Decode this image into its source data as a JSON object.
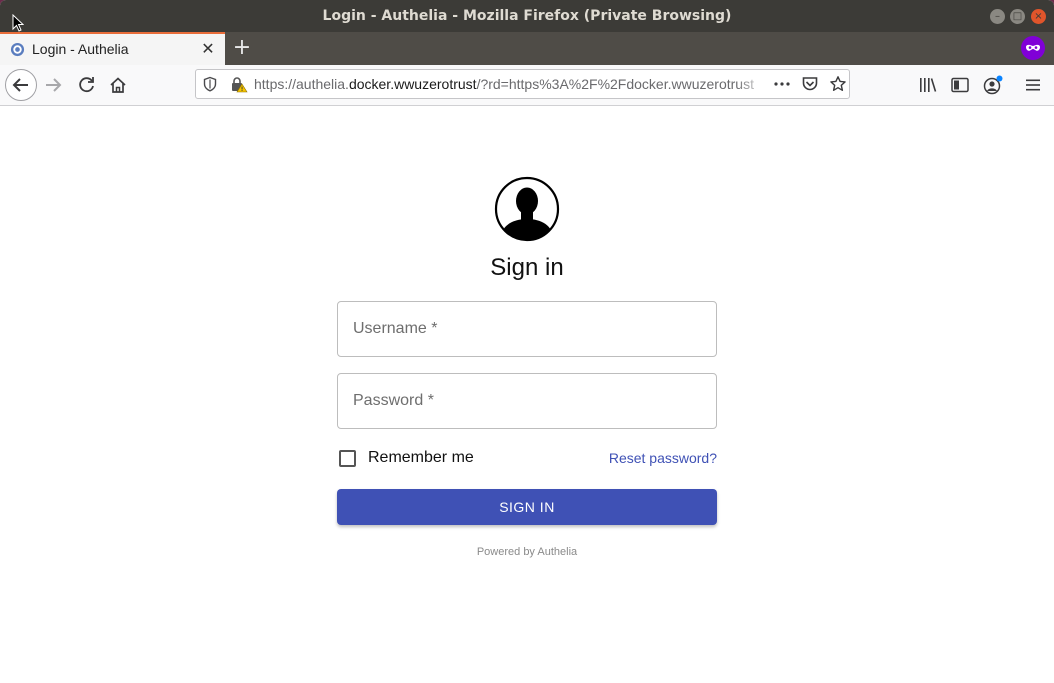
{
  "window": {
    "title": "Login - Authelia - Mozilla Firefox (Private Browsing)",
    "minimize_icon": "minimize-icon",
    "maximize_icon": "maximize-icon",
    "close_icon": "close-icon"
  },
  "tabs": [
    {
      "title": "Login - Authelia",
      "active": true
    }
  ],
  "navbar": {
    "url_prefix": "https://authelia.",
    "url_host": "docker.wwuzerotrust",
    "url_suffix": "/?rd=https%3A%2F%2Fdocker.wwuzerotrust"
  },
  "page": {
    "heading": "Sign in",
    "username_placeholder": "Username *",
    "password_placeholder": "Password *",
    "remember_label": "Remember me",
    "remember_checked": false,
    "reset_link": "Reset password?",
    "submit_label": "SIGN IN",
    "footer": "Powered by Authelia"
  },
  "colors": {
    "primary": "#3f51b5",
    "titlebar": "#3c3b37",
    "tab_accent": "#e96d3a",
    "private_badge": "#8000d7"
  }
}
